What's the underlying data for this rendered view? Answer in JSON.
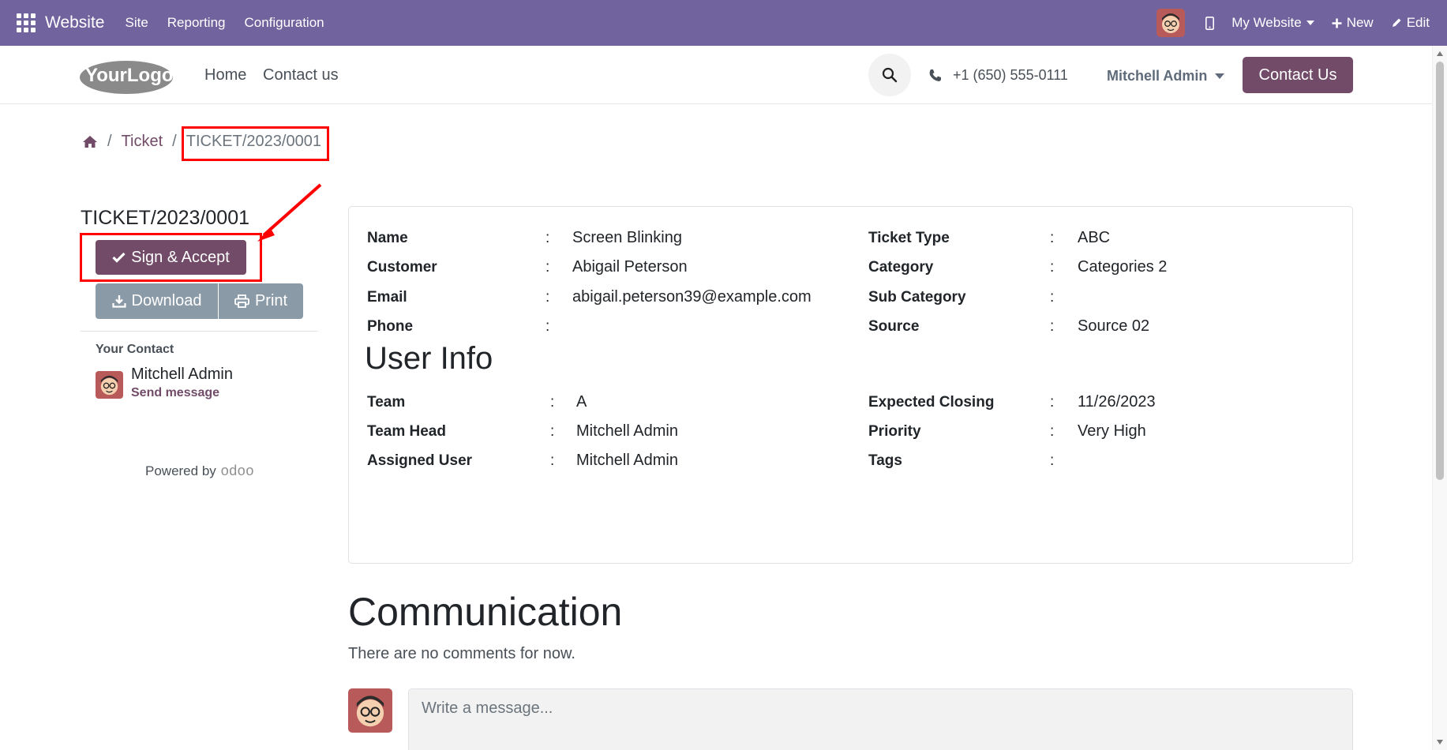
{
  "topbar": {
    "app_name": "Website",
    "menus": [
      "Site",
      "Reporting",
      "Configuration"
    ],
    "website_switch": "My Website",
    "new_label": "New",
    "edit_label": "Edit"
  },
  "header": {
    "logo_text": "YourLogo",
    "nav": [
      "Home",
      "Contact us"
    ],
    "phone": "+1 (650) 555-0111",
    "user": "Mitchell Admin",
    "contact_button": "Contact Us"
  },
  "breadcrumb": {
    "home_icon": "home-icon",
    "section": "Ticket",
    "current": "TICKET/2023/0001"
  },
  "sidebar": {
    "title": "TICKET/2023/0001",
    "sign_button": "Sign & Accept",
    "download_button": "Download",
    "print_button": "Print",
    "contact_heading": "Your Contact",
    "contact_name": "Mitchell Admin",
    "send_message": "Send message",
    "powered_by": "Powered by",
    "odoo": "odoo"
  },
  "details": {
    "left": [
      {
        "label": "Name",
        "value": "Screen Blinking"
      },
      {
        "label": "Customer",
        "value": "Abigail Peterson"
      },
      {
        "label": "Email",
        "value": "abigail.peterson39@example.com"
      },
      {
        "label": "Phone",
        "value": ""
      }
    ],
    "right": [
      {
        "label": "Ticket Type",
        "value": "ABC"
      },
      {
        "label": "Category",
        "value": "Categories 2"
      },
      {
        "label": "Sub Category",
        "value": ""
      },
      {
        "label": "Source",
        "value": "Source 02"
      }
    ],
    "user_info_title": "User Info",
    "user_left": [
      {
        "label": "Team",
        "value": "A"
      },
      {
        "label": "Team Head",
        "value": "Mitchell Admin"
      },
      {
        "label": "Assigned User",
        "value": "Mitchell Admin"
      }
    ],
    "user_right": [
      {
        "label": "Expected Closing",
        "value": "11/26/2023"
      },
      {
        "label": "Priority",
        "value": "Very High"
      },
      {
        "label": "Tags",
        "value": ""
      }
    ]
  },
  "communication": {
    "title": "Communication",
    "empty_text": "There are no comments for now.",
    "input_placeholder": "Write a message..."
  },
  "colors": {
    "topbar": "#71639e",
    "brand": "#714b67",
    "highlight": "#ff0000"
  }
}
